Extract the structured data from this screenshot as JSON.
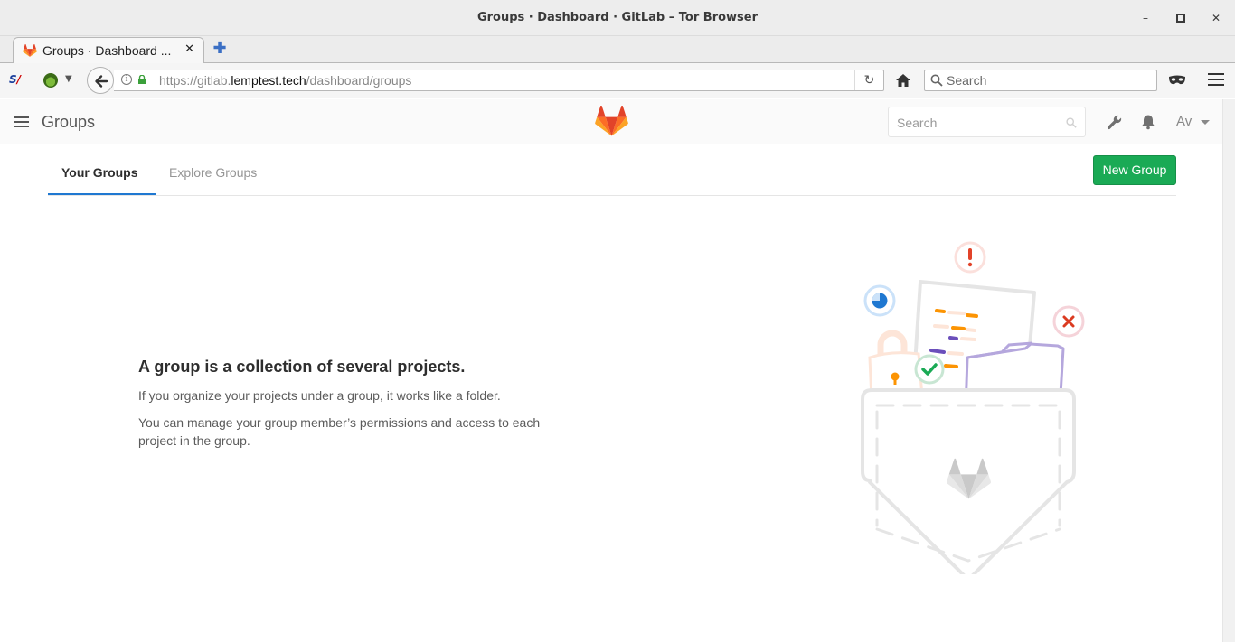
{
  "window": {
    "title": "Groups · Dashboard · GitLab – Tor Browser",
    "minimize": "–",
    "maximize": "▫",
    "close": "✕"
  },
  "browser": {
    "tab_label": "Groups · Dashboard ...",
    "tab_close": "✕",
    "new_tab": "✚",
    "url_prefix": "https://gitlab.",
    "url_domain": "lemptest.tech",
    "url_path": "/dashboard/groups",
    "search_placeholder": "Search",
    "reload": "↻"
  },
  "app": {
    "title": "Groups",
    "search_placeholder": "Search",
    "avatar_text": "Av"
  },
  "tabs": [
    {
      "label": "Your Groups",
      "active": true
    },
    {
      "label": "Explore Groups",
      "active": false
    }
  ],
  "actions": {
    "new_group": "New Group"
  },
  "empty_state": {
    "heading": "A group is a collection of several projects.",
    "line1": "If you organize your projects under a group, it works like a folder.",
    "line2": "You can manage your group member’s permissions and access to each project in the group."
  },
  "colors": {
    "brand_orange": "#e24329",
    "accent_blue": "#1f78d1",
    "success_green": "#1aaa55"
  },
  "icons": [
    "gitlab-logo-icon",
    "search-icon",
    "wrench-icon",
    "bell-icon",
    "hamburger-icon",
    "home-icon",
    "lock-icon",
    "back-arrow-icon",
    "mask-icon"
  ]
}
